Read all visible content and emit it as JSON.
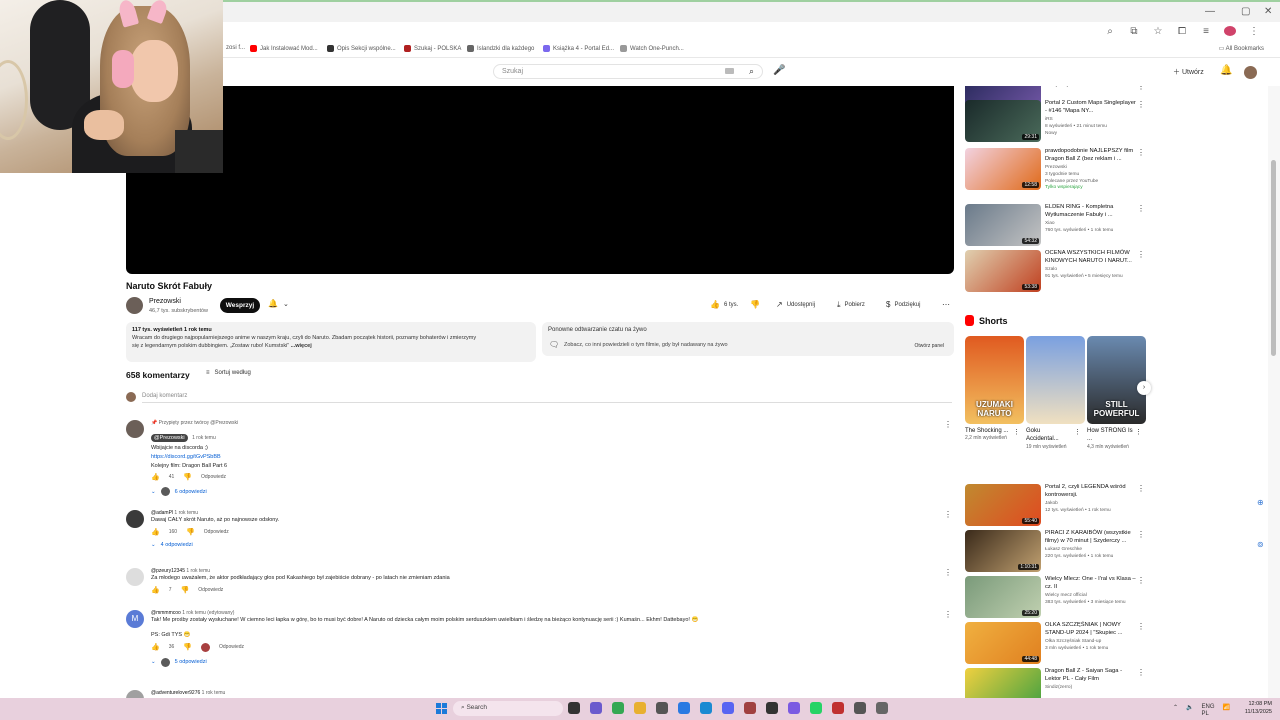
{
  "browser": {
    "window_controls": [
      "—",
      "▢",
      "✕"
    ],
    "bookmarks": [
      {
        "label": "Jak Instalować Mod...",
        "color": "#ff0000"
      },
      {
        "label": "Opis Sekcji wspólne...",
        "color": "#333333"
      },
      {
        "label": "Szukaj - POLSKA",
        "color": "#b02020"
      },
      {
        "label": "Islandzki dla każdego",
        "color": "#666666"
      },
      {
        "label": "Książka 4 - Portal Ed...",
        "color": "#7b68ee"
      },
      {
        "label": "Watch One-Punch...",
        "color": "#999999"
      }
    ],
    "partial_bookmark": "zosi f...",
    "all_bookmarks": "All Bookmarks"
  },
  "header": {
    "search_placeholder": "Szukaj",
    "create_label": "Utwórz"
  },
  "video": {
    "title": "Naruto Skrót Fabuły",
    "channel": "Prezowski",
    "subscribers": "46,7 tys. subskrybentów",
    "support_label": "Wesprzyj",
    "actions": {
      "likes": "6 tys.",
      "share": "Udostępnij",
      "download": "Pobierz",
      "thanks": "Podziękuj"
    },
    "description": {
      "meta": "117 tys. wyświetleń  1 rok temu",
      "line1": "Wracam do drugiego najpopularniejszego anime w naszym kraju, czyli do Naruto. Zbadam początek historii, poznamy bohaterów i zmierzymy",
      "line2": "się z legendarnym polskim dubbingiem. „Zostaw rubo! Kumstski”",
      "more": "...więcej"
    },
    "live": {
      "title": "Ponowne odtwarzanie czatu na żywo",
      "desc": "Zobacz, co inni powiedzieli o tym filmie, gdy był nadawany na żywo",
      "button": "Otwórz panel"
    }
  },
  "comments": {
    "count_label": "658 komentarzy",
    "sort_label": "Sortuj według",
    "add_placeholder": "Dodaj komentarz",
    "reply_label": "Odpowiedz",
    "items": [
      {
        "pinned": "Przypięty przez twórcę @Prezowski",
        "author": "@Prezowski",
        "time": "1 rok temu",
        "lines": [
          "Wbijajcie na discorda ;)"
        ],
        "link": "https://discord.gg/tGvPSbBB",
        "after": "Kolejny film: Dragon Ball Part 6",
        "likes": "41",
        "replies": "6 odpowiedzi",
        "avatar_color": "#6b5f58"
      },
      {
        "author": "@adamPl",
        "time": "1 rok temu",
        "lines": [
          "Dawaj CAŁY skrót Naruto, aż po najnowsze odsłony."
        ],
        "likes": "160",
        "replies": "4 odpowiedzi",
        "avatar_color": "#3a3a3a"
      },
      {
        "author": "@pzeury12345",
        "time": "1 rok temu",
        "lines": [
          "Za młodego uważałem, że aktor podkładający głos pod Kakashiego był zajebiście dobrany - po latach nie zmieniam zdania"
        ],
        "likes": "7",
        "avatar_color": "#dddddd"
      },
      {
        "author": "@mmmmcoo",
        "time": "1 rok temu (edytowany)",
        "lines": [
          "Tak! Me prośby zostały wysłuchane! W ciemno leci łapka w górę, bo to musi być dobre! A Naruto od dziecka całym moim polskim serduszkiem uwielbiam i śledzę na bieżąco kontynuację serii :) Kumaśn... Ekhm! Dattebayo! 😁",
          "PS: Gdi TYS 😁"
        ],
        "likes": "36",
        "replies": "5 odpowiedzi",
        "avatar_letter": "M",
        "avatar_color": "#5a7bd6"
      },
      {
        "author": "@adventurelover9276",
        "time": "1 rok temu",
        "lines": [],
        "avatar_color": "#a0a0a0"
      }
    ]
  },
  "sidebar": {
    "recs": [
      {
        "title": "",
        "meta": [
          "153 tys. wyświetleń • 1 rok temu"
        ],
        "duration": "22:29",
        "colors": [
          "#2b2b5e",
          "#7a5cae"
        ]
      },
      {
        "title": "Portal 2 Custom Maps Singleplayer - #146 \"Mapa NY...",
        "meta": [
          "iRS",
          "8 wyświetleń • 21 minut temu",
          "Nowy"
        ],
        "duration": "29:31",
        "colors": [
          "#1a2a2a",
          "#4a6a5a"
        ]
      },
      {
        "title": "prawdopodobnie NAJLEPSZY film Dragon Ball Z (bez reklam i ...",
        "meta": [
          "Prezowski",
          "3 tygodnie temu",
          "Polecane przez YouTube"
        ],
        "green": "Tylko wspierający",
        "duration": "12:58",
        "colors": [
          "#f2d2e0",
          "#e06a1a"
        ]
      },
      {
        "title": "ELDEN RING - Kompletna Wytłumaczenie Fabuły i ...",
        "meta": [
          "Xiao",
          "760 tys. wyświetleń • 1 rok temu"
        ],
        "duration": "54:32",
        "colors": [
          "#6a7a8a",
          "#c4c4c4"
        ]
      },
      {
        "title": "OCENA WSZYSTKICH FILMÓW KINOWYCH NARUTO I NARUT...",
        "meta": [
          "Szalo",
          "91 tys. wyświetleń • 5 miesięcy temu"
        ],
        "duration": "53:38",
        "colors": [
          "#e0d0b0",
          "#c04020"
        ]
      },
      {
        "title": "Portal 2, czyli LEGENDA wśród kontrowersji.",
        "meta": [
          "Jakob",
          "12 tys. wyświetleń • 1 rok temu"
        ],
        "duration": "55:40",
        "colors": [
          "#c08a30",
          "#e04a20"
        ]
      },
      {
        "title": "PIRACI Z KARAIBÓW (wszystkie filmy) w 70 minut | Szyderczy ...",
        "meta": [
          "Łukasz Greschke",
          "220 tys. wyświetleń • 1 rok temu"
        ],
        "duration": "1:10:31",
        "colors": [
          "#3a2a1a",
          "#c0a070"
        ]
      },
      {
        "title": "Wielcy Mlecz: One - I'ral vs Klasa – cz. II",
        "meta": [
          "Wielcy mecz official",
          "383 tys. wyświetleń • 3 miesiące temu"
        ],
        "duration": "25:20",
        "colors": [
          "#7a9a7a",
          "#c0d0b0"
        ]
      },
      {
        "title": "OLKA SZCZĘŚNIAK | NOWY STAND-UP 2024 | \"Skupiec ...",
        "meta": [
          "Olka Szczęśniak Stand-up",
          "3 mln wyświetleń • 1 rok temu"
        ],
        "duration": "44:48",
        "colors": [
          "#f0b040",
          "#e08020"
        ]
      },
      {
        "title": "Dragon Ball Z - Saiyan Saga - Lektor PL - Cały Film",
        "meta": [
          "Sindiz(zerro)"
        ],
        "duration": "",
        "colors": [
          "#f0d040",
          "#40a040"
        ]
      }
    ],
    "shorts_title": "Shorts",
    "shorts": [
      {
        "title": "The Shocking ...",
        "meta": "2,2 mln wyświetleń",
        "caption": "UZUMAKI NARUTO",
        "colors": [
          "#e05a20",
          "#f2c060"
        ]
      },
      {
        "title": "Goku Accidental...",
        "meta": "19 mln wyświetleń",
        "caption": "",
        "colors": [
          "#7aa0e0",
          "#f0e0c0"
        ]
      },
      {
        "title": "How STRONG Is ...",
        "meta": "4,3 mln wyświetleń",
        "caption": "STILL POWERFUL",
        "colors": [
          "#6a8ab0",
          "#2a2a2a"
        ]
      }
    ]
  },
  "taskbar": {
    "search_label": "Search",
    "lang": "ENG",
    "lang_sub": "PL",
    "time": "12:08 PM",
    "date": "11/13/2025"
  }
}
